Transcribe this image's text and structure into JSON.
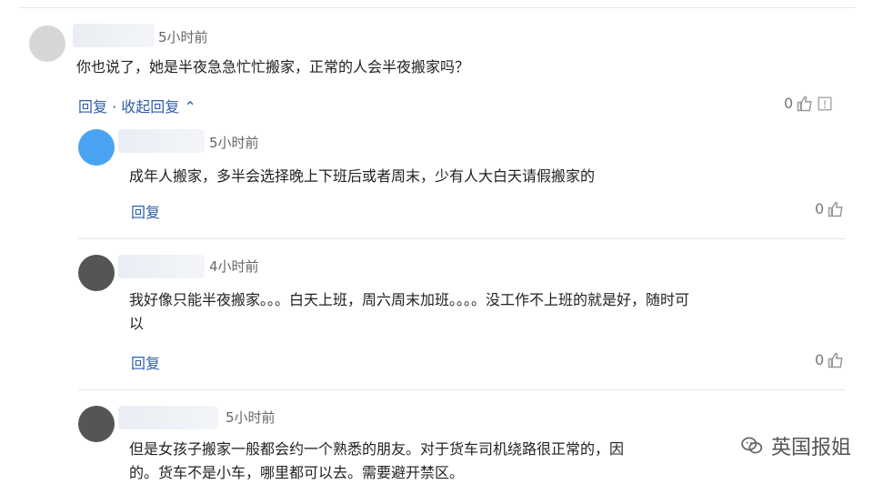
{
  "comments": [
    {
      "time": "5小时前",
      "text": "你也说了，她是半夜急急忙忙搬家，正常的人会半夜搬家吗？",
      "reply": "回复",
      "collapse": "收起回复",
      "likes": "0"
    },
    {
      "time": "5小时前",
      "text": "成年人搬家，多半会选择晚上下班后或者周末，少有人大白天请假搬家的",
      "reply": "回复",
      "likes": "0"
    },
    {
      "time": "4小时前",
      "text1": "我好像只能半夜搬家。。。白天上班，周六周末加班。。。。没工作不上班的就是好，随时可",
      "text2": "以",
      "reply": "回复",
      "likes": "0"
    },
    {
      "time": "5小时前",
      "text1": "但是女孩子搬家一般都会约一个熟悉的朋友。对于货车司机绕路很正常的，因",
      "text2": "的。货车不是小车，哪里都可以去。需要避开禁区。"
    }
  ],
  "watermark": "英国报姐",
  "icons": [
    "thumb-up-icon",
    "report-icon",
    "chevron-up-icon",
    "wechat-icon"
  ]
}
